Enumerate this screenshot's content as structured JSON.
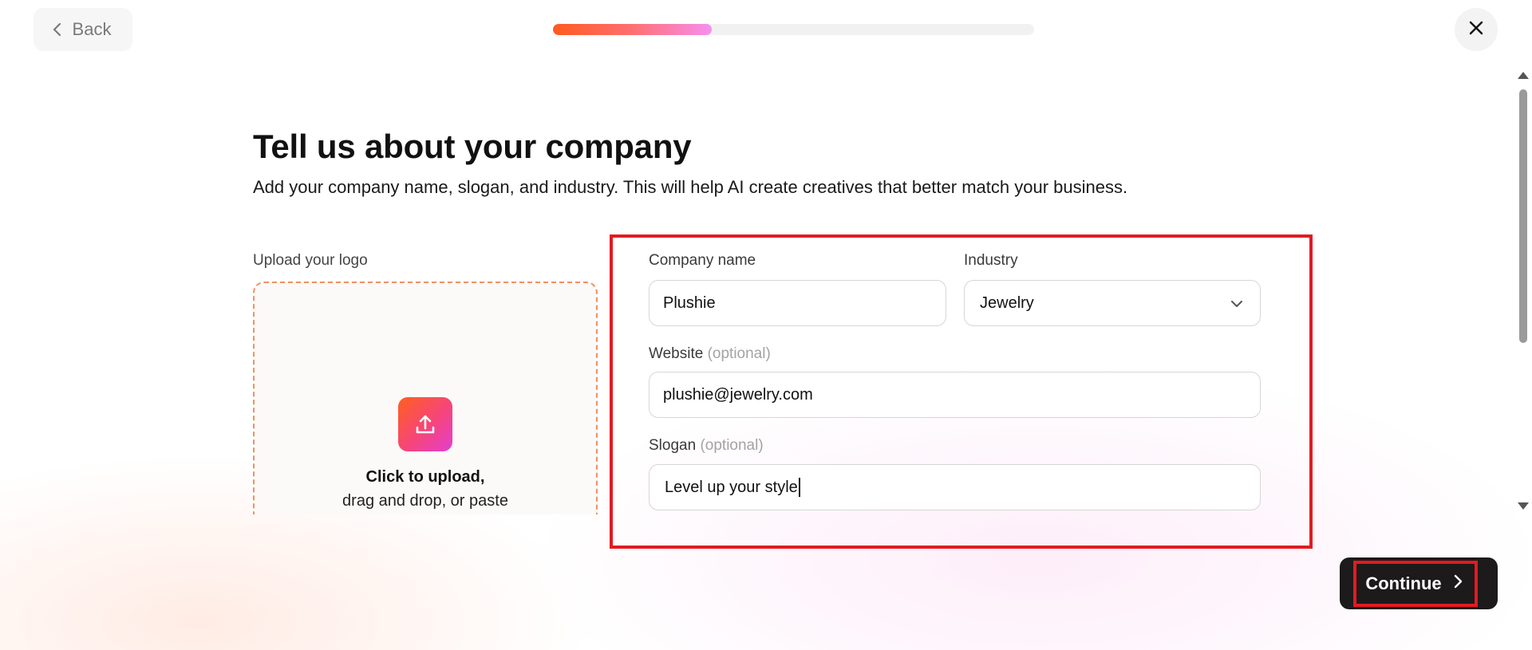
{
  "header": {
    "back_label": "Back",
    "progress_percent": 33,
    "close_icon": "close-icon",
    "back_icon": "chevron-left-icon"
  },
  "page": {
    "title": "Tell us about your company",
    "subtitle": "Add your company name, slogan, and industry. This will help AI create creatives that better match your business."
  },
  "upload": {
    "label": "Upload your logo",
    "icon": "upload-icon",
    "primary_text": "Click to upload,",
    "secondary_text": "drag and drop, or paste"
  },
  "form": {
    "company_name": {
      "label": "Company name",
      "value": "Plushie"
    },
    "industry": {
      "label": "Industry",
      "value": "Jewelry",
      "icon": "chevron-down-icon"
    },
    "website": {
      "label": "Website",
      "optional": "(optional)",
      "value": "plushie@jewelry.com"
    },
    "slogan": {
      "label": "Slogan",
      "optional": "(optional)",
      "value": "Level up your style"
    }
  },
  "footer": {
    "continue_label": "Continue",
    "continue_icon": "chevron-right-icon"
  },
  "colors": {
    "highlight": "#e11b22",
    "progress_start": "#ff5a1f",
    "progress_end": "#f68ff0",
    "button_dark": "#1c1a1a"
  }
}
